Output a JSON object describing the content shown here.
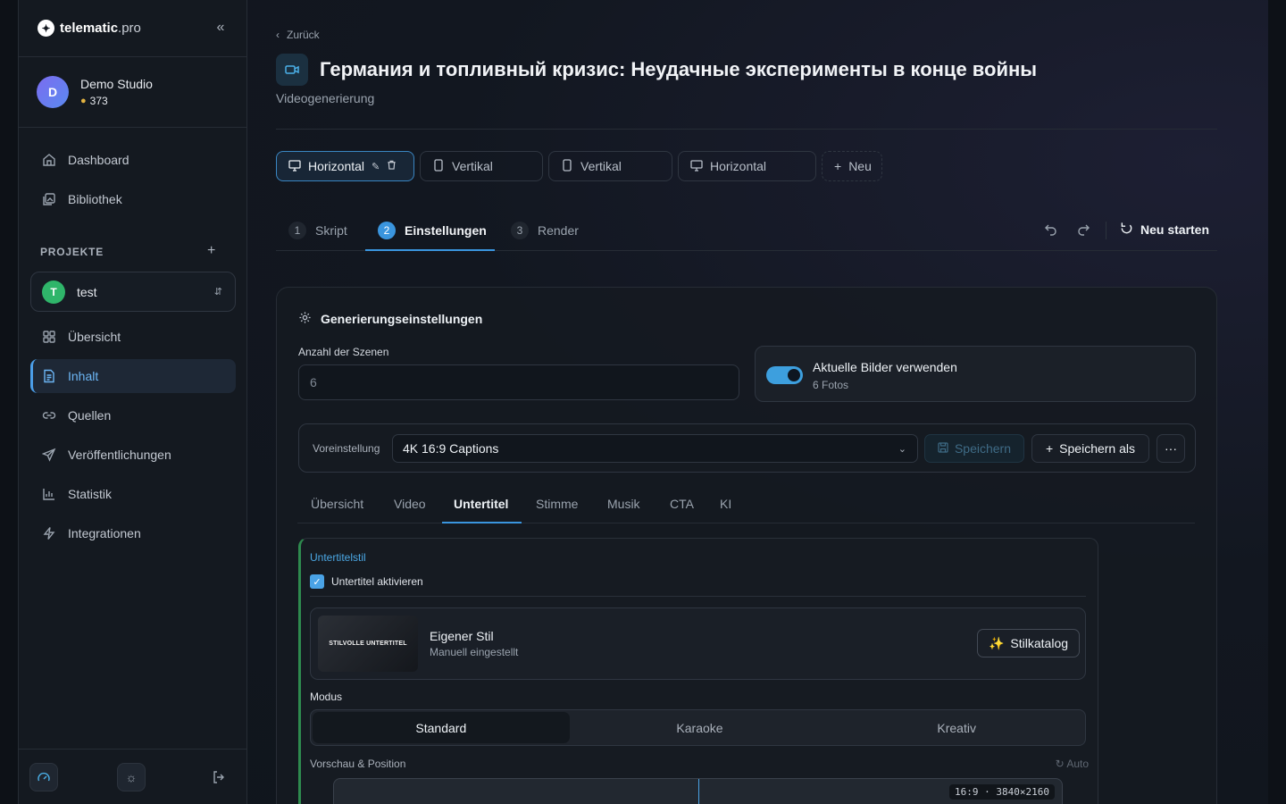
{
  "app": {
    "logo_name": "telematic",
    "logo_suffix": ".pro"
  },
  "user": {
    "initial": "D",
    "name": "Demo Studio",
    "credits": "373"
  },
  "nav": {
    "dashboard": "Dashboard",
    "library": "Bibliothek",
    "section_title": "PROJEKTE",
    "project_initial": "T",
    "project_name": "test",
    "overview": "Übersicht",
    "content": "Inhalt",
    "sources": "Quellen",
    "publications": "Veröffentlichungen",
    "statistics": "Statistik",
    "integrations": "Integrationen"
  },
  "header": {
    "back": "Zurück",
    "title": "Германия и топливный кризис: Неудачные эксперименты в конце войны",
    "subtitle": "Videogenerierung"
  },
  "variants": [
    "Horizontal",
    "Vertikal",
    "Vertikal",
    "Horizontal"
  ],
  "variant_new": "Neu",
  "steps": [
    {
      "num": "1",
      "label": "Skript"
    },
    {
      "num": "2",
      "label": "Einstellungen"
    },
    {
      "num": "3",
      "label": "Render"
    }
  ],
  "restart": "Neu starten",
  "settings": {
    "title": "Generierungseinstellungen",
    "scene_count_label": "Anzahl der Szenen",
    "scene_count_placeholder": "6",
    "toggle_title": "Aktuelle Bilder verwenden",
    "toggle_sub": "6 Fotos",
    "toggle_on": true
  },
  "preset": {
    "label": "Voreinstellung",
    "value": "4K 16:9 Captions",
    "save": "Speichern",
    "save_as": "Speichern als",
    "more": "···"
  },
  "subtabs": [
    "Übersicht",
    "Video",
    "Untertitel",
    "Stimme",
    "Musik",
    "CTA",
    "KI"
  ],
  "subtitle_panel": {
    "section": "Untertitelstil",
    "enable": "Untertitel aktivieren",
    "thumb_text": "STILVOLLE UNTERTITEL",
    "style_name": "Eigener Stil",
    "style_sub": "Manuell eingestellt",
    "catalog": "Stilkatalog",
    "mode_label": "Modus",
    "modes": [
      "Standard",
      "Karaoke",
      "Kreativ"
    ],
    "preview_label": "Vorschau & Position",
    "auto": "Auto",
    "resolution": "16:9 · 3840×2160"
  },
  "colors": {
    "accent": "#3a95de",
    "toggle": "#3d9fde",
    "project": "#2fb56a"
  }
}
